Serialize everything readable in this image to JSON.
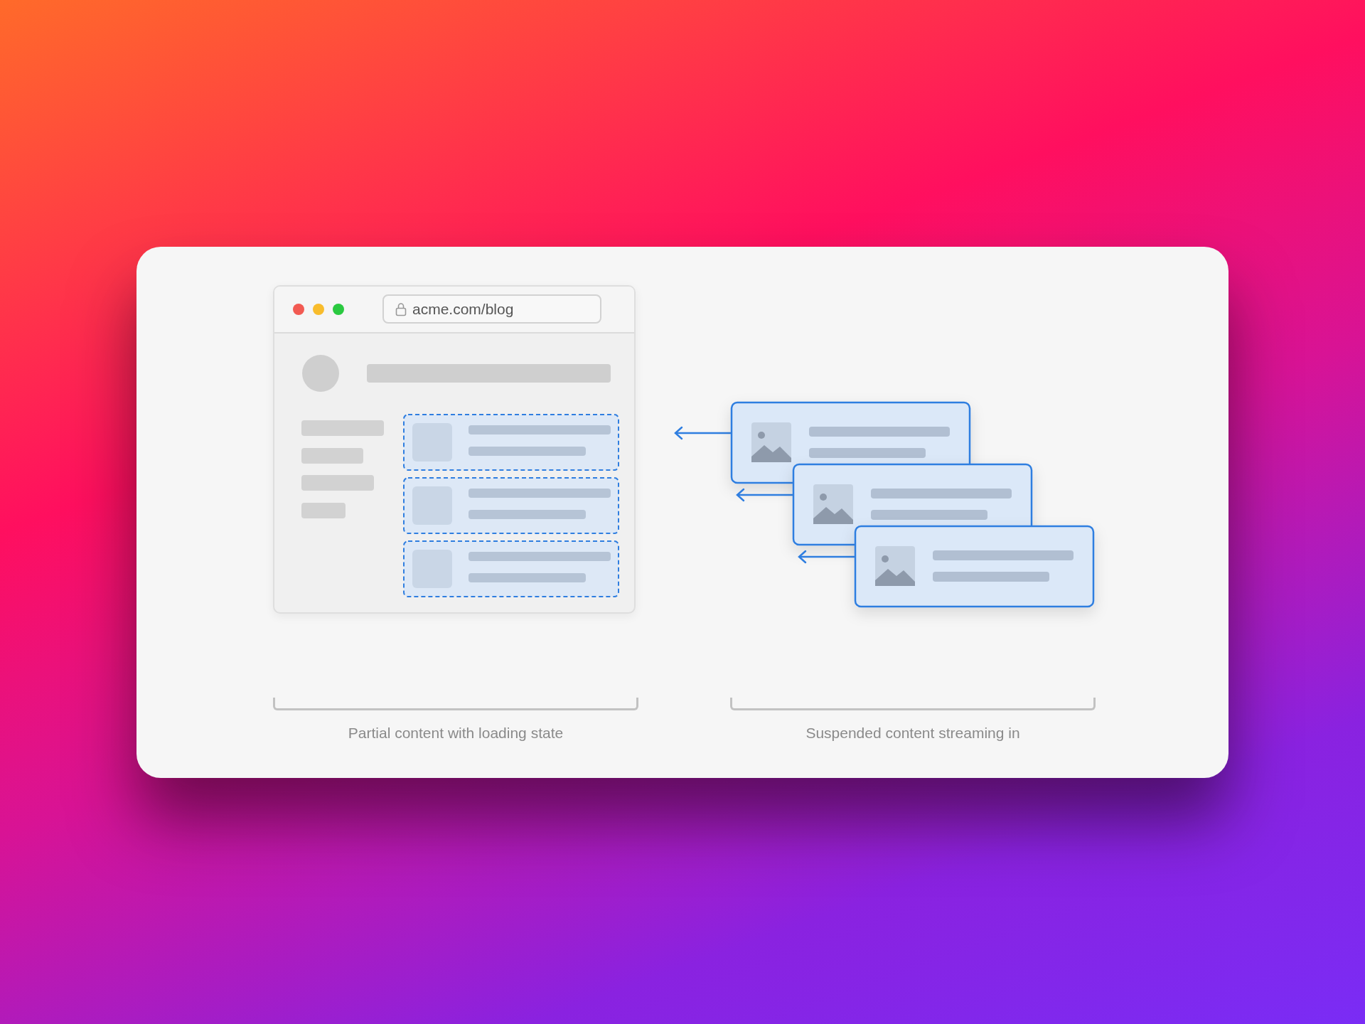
{
  "browser": {
    "url": "acme.com/blog"
  },
  "captions": [
    "Partial content with loading state",
    "Suspended content streaming in"
  ]
}
